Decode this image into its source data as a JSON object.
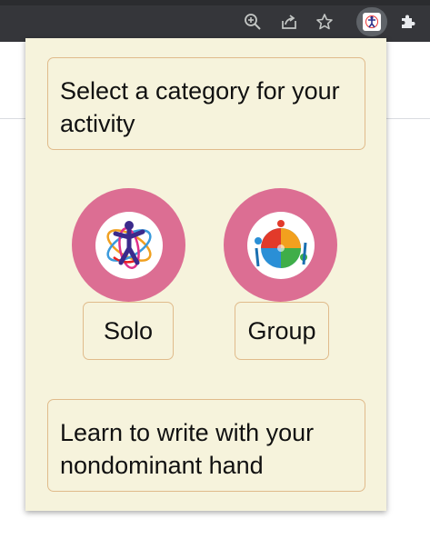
{
  "browser": {
    "toolbar_icons": [
      "zoom-icon",
      "share-icon",
      "bookmark-star-icon",
      "extension-active-icon",
      "extensions-puzzle-icon"
    ]
  },
  "popup": {
    "heading": "Select a category for your activity",
    "categories": [
      {
        "label": "Solo",
        "icon": "solo-dancer-icon"
      },
      {
        "label": "Group",
        "icon": "group-puzzle-icon"
      }
    ],
    "suggestion": "Learn to write with your nondominant hand"
  },
  "colors": {
    "popup_background": "#f6f3dc",
    "box_border": "#e0bb8b",
    "category_circle": "#dc6e93",
    "toolbar": "#35363a"
  }
}
